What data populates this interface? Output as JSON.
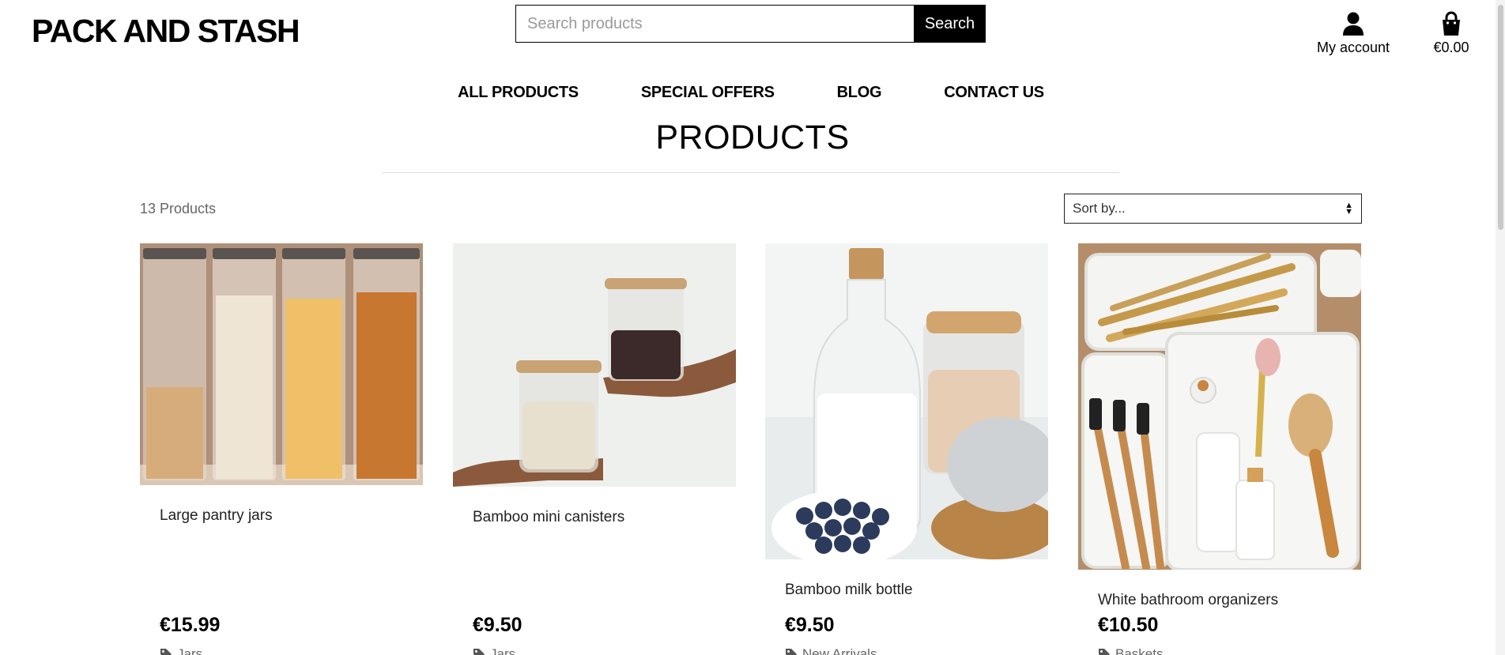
{
  "header": {
    "logo": "PACK AND STASH",
    "search": {
      "placeholder": "Search products",
      "button_label": "Search"
    },
    "account_label": "My account",
    "cart_total": "€0.00",
    "icons": {
      "account": "user-icon",
      "cart": "shopping-bag-icon"
    }
  },
  "nav": {
    "items": [
      {
        "label": "ALL PRODUCTS"
      },
      {
        "label": "SPECIAL OFFERS"
      },
      {
        "label": "BLOG"
      },
      {
        "label": "CONTACT US"
      }
    ]
  },
  "page": {
    "title": "PRODUCTS",
    "product_count": "13 Products",
    "sort": {
      "selected": "Sort by..."
    }
  },
  "products": [
    {
      "name": "Large pantry jars",
      "price": "€15.99",
      "category": "Jars",
      "image": "glass-jars-with-oats-rice-pasta"
    },
    {
      "name": "Bamboo mini canisters",
      "price": "€9.50",
      "category": "Jars",
      "image": "hands-holding-small-jars"
    },
    {
      "name": "Bamboo milk bottle",
      "price": "€9.50",
      "category": "New Arrivals",
      "image": "milk-bottle-oat-jar-blueberries"
    },
    {
      "name": "White bathroom organizers",
      "price": "€10.50",
      "category": "Baskets",
      "image": "drawer-organizer-with-brushes"
    }
  ],
  "colors": {
    "primary": "#000000",
    "muted_text": "#666666",
    "divider": "#dcdcdc"
  }
}
